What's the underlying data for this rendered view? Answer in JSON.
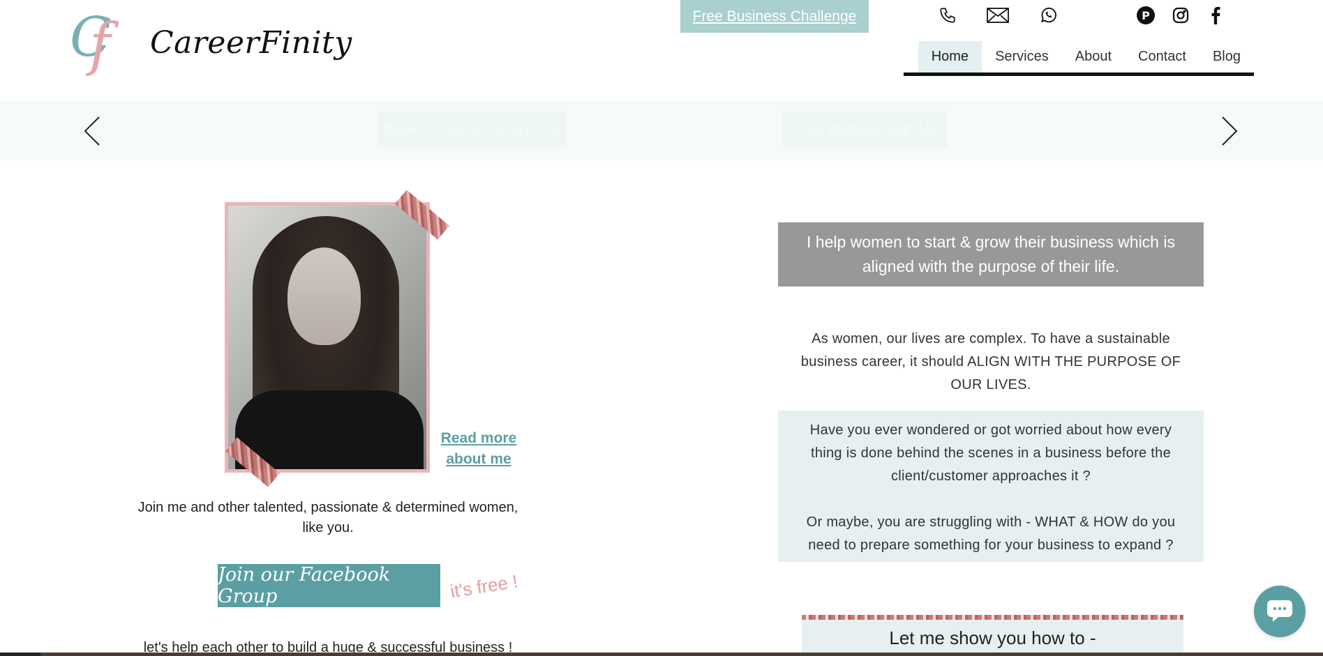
{
  "brand": {
    "logo_text": "Cf",
    "name": "CareerFinity"
  },
  "header": {
    "challenge_label": "Free Business Challenge",
    "contact_icons": [
      "phone-icon",
      "mail-icon",
      "whatsapp-icon"
    ],
    "social_icons": [
      "pinterest-icon",
      "instagram-icon",
      "facebook-icon"
    ]
  },
  "nav": {
    "items": [
      {
        "label": "Home",
        "active": true
      },
      {
        "label": "Services",
        "active": false
      },
      {
        "label": "About",
        "active": false
      },
      {
        "label": "Contact",
        "active": false
      },
      {
        "label": "Blog",
        "active": false
      }
    ]
  },
  "slider": {
    "button_1": "Book A Free Discovery Call",
    "button_2": "Free Webinar Sign Up"
  },
  "about": {
    "read_more": "Read more about me",
    "join_text": "Join me and other talented, passionate & determined women, like you.",
    "fb_button": "Join our Facebook Group",
    "free_note": "it's free !",
    "help_text": "let's help each other to build a huge & successful business !"
  },
  "main": {
    "headline": "I help women to start & grow their business which is aligned with the purpose of their life.",
    "intro": "As women, our lives are complex. To have a sustainable business career, it should ALIGN WITH THE PURPOSE OF OUR LIVES.",
    "question_1": "Have you ever wondered or got worried about how every thing is done behind the scenes in a business before the client/customer approaches it ?",
    "question_2": "Or maybe, you are struggling with - WHAT & HOW do you need to prepare something for your business to expand ?",
    "show_title": "Let me show you how to -"
  },
  "colors": {
    "teal": "#5c9fa3",
    "light_teal": "#a9cfcf",
    "pale_teal": "#e6f0f0",
    "gray_box": "#989898",
    "pink": "#e29ea2"
  }
}
